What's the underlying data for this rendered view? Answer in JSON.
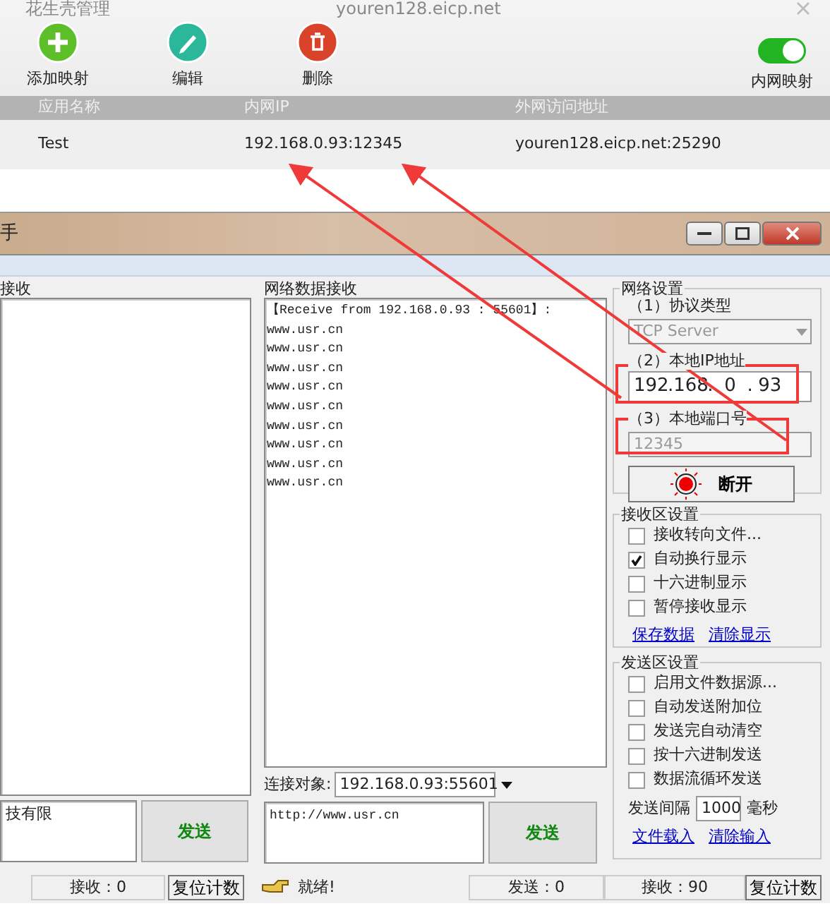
{
  "manager_window": {
    "title": "花生壳管理",
    "host": "youren128.eicp.net",
    "toolbar": [
      {
        "label": "添加映射",
        "kind": "add"
      },
      {
        "label": "编辑",
        "kind": "edit"
      },
      {
        "label": "删除",
        "kind": "delete"
      }
    ],
    "toggle": {
      "label": "内网映射",
      "on": true
    },
    "table": {
      "columns": [
        "应用名称",
        "内网IP",
        "外网访问地址"
      ],
      "rows": [
        [
          "Test",
          "192.168.0.93:12345",
          "youren128.eicp.net:25290"
        ]
      ]
    }
  },
  "assistant_window": {
    "title": "手",
    "left_panel": {
      "label": "接收",
      "send_text": "技有限",
      "send_button": "发送"
    },
    "receive_panel": {
      "label": "网络数据接收",
      "lines": [
        "【Receive from 192.168.0.93 : 55601】:",
        "www.usr.cn",
        "www.usr.cn",
        "www.usr.cn",
        "www.usr.cn",
        "www.usr.cn",
        "www.usr.cn",
        "www.usr.cn",
        "www.usr.cn",
        "www.usr.cn"
      ],
      "connection_label": "连接对象:",
      "connection_value": "192.168.0.93:55601",
      "send_text": "http://www.usr.cn",
      "send_button": "发送"
    },
    "network_settings": {
      "title": "网络设置",
      "protocol_label": "（1）协议类型",
      "protocol": "TCP Server",
      "protocol_disabled": true,
      "ip_label": "（2）本地IP地址",
      "ip_parts": [
        "192",
        "168",
        "0",
        "93"
      ],
      "ip_separator": ".",
      "port_label": "（3）本地端口号",
      "port": "12345",
      "port_disabled": true,
      "connect_button": "断开"
    },
    "receive_settings": {
      "title": "接收区设置",
      "options": [
        {
          "label": "接收转向文件...",
          "checked": false
        },
        {
          "label": "自动换行显示",
          "checked": true
        },
        {
          "label": "十六进制显示",
          "checked": false
        },
        {
          "label": "暂停接收显示",
          "checked": false
        }
      ],
      "links": [
        "保存数据",
        "清除显示"
      ]
    },
    "send_settings": {
      "title": "发送区设置",
      "options": [
        {
          "label": "启用文件数据源...",
          "checked": false
        },
        {
          "label": "自动发送附加位",
          "checked": false
        },
        {
          "label": "发送完自动清空",
          "checked": false
        },
        {
          "label": "按十六进制发送",
          "checked": false
        },
        {
          "label": "数据流循环发送",
          "checked": false
        }
      ],
      "interval_label": "发送间隔",
      "interval": "1000",
      "interval_unit": "毫秒",
      "links": [
        "文件载入",
        "清除输入"
      ]
    },
    "status_bar": {
      "left_count": "接收：0",
      "left_reset": "复位计数",
      "status": "就绪!",
      "sent": "发送：0",
      "received": "接收：90",
      "reset": "复位计数"
    }
  }
}
